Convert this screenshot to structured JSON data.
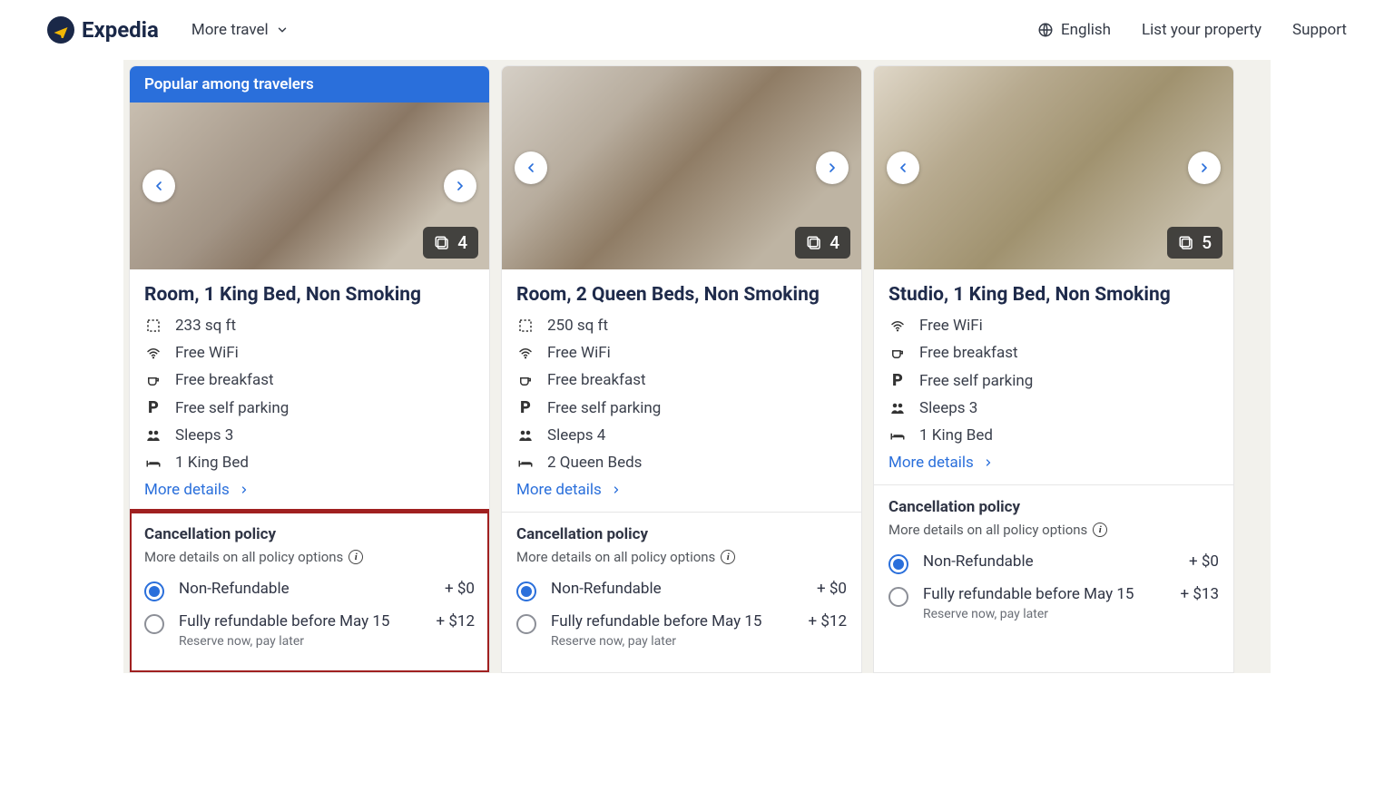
{
  "header": {
    "logo_text": "Expedia",
    "more_travel": "More travel",
    "language": "English",
    "list_property": "List your property",
    "support": "Support"
  },
  "rooms": [
    {
      "popular_badge": "Popular among travelers",
      "image_count": "4",
      "title": "Room, 1 King Bed, Non Smoking",
      "amenities": {
        "size": "233 sq ft",
        "wifi": "Free WiFi",
        "breakfast": "Free breakfast",
        "parking": "Free self parking",
        "sleeps": "Sleeps 3",
        "bed": "1 King Bed"
      },
      "more_details": "More details",
      "policy_title": "Cancellation policy",
      "policy_more": "More details on all policy options",
      "options": [
        {
          "label": "Non-Refundable",
          "sub": "",
          "price": "+ $0",
          "selected": true
        },
        {
          "label": "Fully refundable before May 15",
          "sub": "Reserve now, pay later",
          "price": "+ $12",
          "selected": false
        }
      ]
    },
    {
      "popular_badge": "",
      "image_count": "4",
      "title": "Room, 2 Queen Beds, Non Smoking",
      "amenities": {
        "size": "250 sq ft",
        "wifi": "Free WiFi",
        "breakfast": "Free breakfast",
        "parking": "Free self parking",
        "sleeps": "Sleeps 4",
        "bed": "2 Queen Beds"
      },
      "more_details": "More details",
      "policy_title": "Cancellation policy",
      "policy_more": "More details on all policy options",
      "options": [
        {
          "label": "Non-Refundable",
          "sub": "",
          "price": "+ $0",
          "selected": true
        },
        {
          "label": "Fully refundable before May 15",
          "sub": "Reserve now, pay later",
          "price": "+ $12",
          "selected": false
        }
      ]
    },
    {
      "popular_badge": "",
      "image_count": "5",
      "title": "Studio, 1 King Bed, Non Smoking",
      "amenities": {
        "size": "",
        "wifi": "Free WiFi",
        "breakfast": "Free breakfast",
        "parking": "Free self parking",
        "sleeps": "Sleeps 3",
        "bed": "1 King Bed"
      },
      "more_details": "More details",
      "policy_title": "Cancellation policy",
      "policy_more": "More details on all policy options",
      "options": [
        {
          "label": "Non-Refundable",
          "sub": "",
          "price": "+ $0",
          "selected": true
        },
        {
          "label": "Fully refundable before May 15",
          "sub": "Reserve now, pay later",
          "price": "+ $13",
          "selected": false
        }
      ]
    }
  ]
}
